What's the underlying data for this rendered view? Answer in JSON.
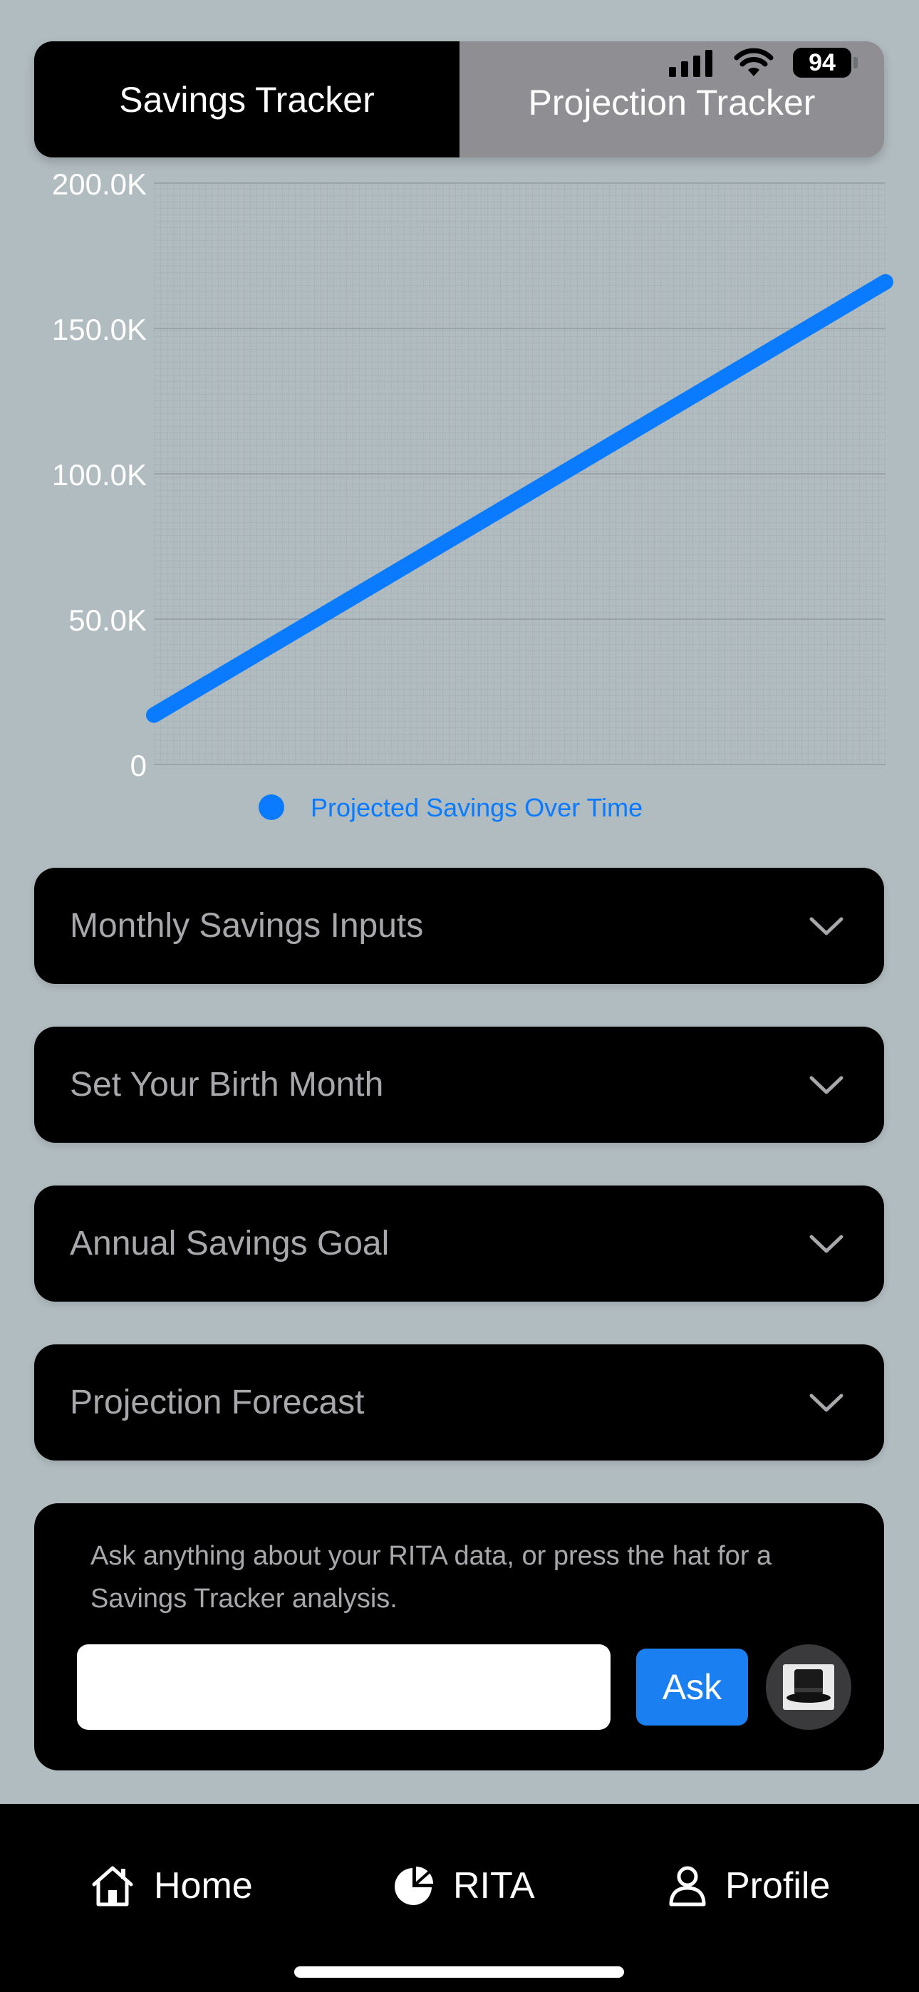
{
  "status_bar": {
    "battery": "94",
    "icons": [
      "signal-icon",
      "wifi-icon",
      "battery-icon"
    ]
  },
  "tabs": [
    {
      "label": "Savings Tracker",
      "active": true
    },
    {
      "label": "Projection Tracker",
      "active": false
    }
  ],
  "chart_data": {
    "type": "line",
    "title": "",
    "xlabel": "",
    "ylabel": "",
    "ylim": [
      0,
      200000
    ],
    "y_ticks": [
      "200.0K",
      "150.0K",
      "100.0K",
      "50.0K",
      "0"
    ],
    "y_tick_values": [
      200000,
      150000,
      100000,
      50000,
      0
    ],
    "grid": true,
    "legend_position": "bottom",
    "series": [
      {
        "name": "Projected Savings Over Time",
        "color": "#0a7bff",
        "y": [
          17000,
          166000
        ]
      }
    ]
  },
  "accordions": [
    {
      "label": "Monthly Savings Inputs",
      "icon": "chevron-down-icon"
    },
    {
      "label": "Set Your Birth Month",
      "icon": "chevron-down-icon"
    },
    {
      "label": "Annual Savings Goal",
      "icon": "chevron-down-icon"
    },
    {
      "label": "Projection Forecast",
      "icon": "chevron-down-icon"
    }
  ],
  "ask": {
    "prompt": "Ask anything about your RITA data, or press the hat for a Savings Tracker analysis.",
    "input_value": "",
    "input_placeholder": "",
    "button_label": "Ask",
    "hat_icon": "top-hat-icon"
  },
  "bottom_nav": [
    {
      "label": "Home",
      "icon": "home-icon"
    },
    {
      "label": "RITA",
      "icon": "pie-chart-icon"
    },
    {
      "label": "Profile",
      "icon": "person-icon"
    }
  ],
  "colors": {
    "accent": "#0a7bff",
    "background": "#b1bcc0",
    "panel": "#000000",
    "muted_text": "#a8a8ac"
  }
}
